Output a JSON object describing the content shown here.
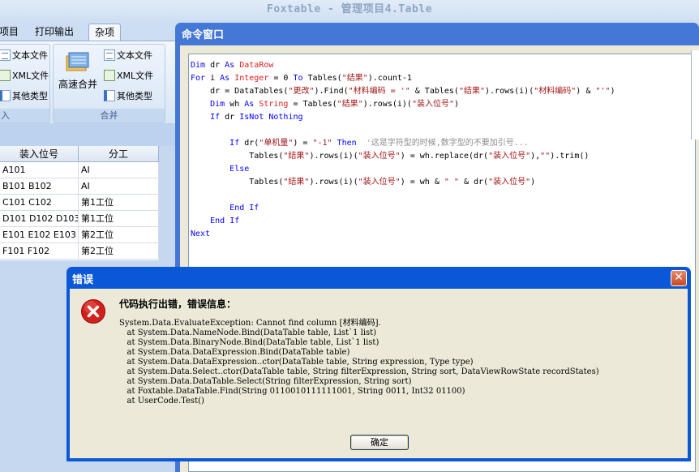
{
  "app": {
    "title": "Foxtable - 管理项目4.Table"
  },
  "tabs": [
    {
      "label": "项目"
    },
    {
      "label": "打印输出"
    },
    {
      "label": "杂项"
    }
  ],
  "ribbon": {
    "left_group": {
      "items": [
        "文本文件",
        "XML文件",
        "其他类型"
      ],
      "label": "入"
    },
    "merge_group": {
      "big_button": "高速合并",
      "items": [
        "文本文件",
        "XML文件",
        "其他类型"
      ],
      "label": "合并"
    }
  },
  "grid": {
    "columns": [
      "装入位号",
      "分工"
    ],
    "rows": [
      [
        "A101",
        "AI"
      ],
      [
        "B101 B102",
        "AI"
      ],
      [
        "C101 C102",
        "第1工位"
      ],
      [
        "D101 D102 D103",
        "第1工位"
      ],
      [
        "E101 E102 E103",
        "第2工位"
      ],
      [
        "F101 F102",
        "第2工位"
      ]
    ]
  },
  "command_window": {
    "title": "命令窗口",
    "code_lines": [
      "Dim dr As DataRow",
      "For i As Integer = 0 To Tables(\"结果\").count-1",
      "    dr = DataTables(\"更改\").Find(\"材料编码 = '\" & Tables(\"结果\").rows(i)(\"材料编码\") & \"'\")",
      "    Dim wh As String = Tables(\"结果\").rows(i)(\"装入位号\")",
      "    If dr IsNot Nothing",
      "",
      "        If dr(\"单机量\") = \"-1\" Then  '这是字符型的时候,数字型的不要加引号...",
      "            Tables(\"结果\").rows(i)(\"装入位号\") = wh.replace(dr(\"装入位号\"),\"\").trim()",
      "        Else",
      "            Tables(\"结果\").rows(i)(\"装入位号\") = wh & \" \" & dr(\"装入位号\")",
      "",
      "        End If",
      "    End If",
      "Next"
    ]
  },
  "error_dialog": {
    "title": "错误",
    "close_symbol": "✕",
    "headline": "代码执行出错，错误信息：",
    "details": [
      "System.Data.EvaluateException: Cannot find column [材料编码].",
      "   at System.Data.NameNode.Bind(DataTable table, List`1 list)",
      "   at System.Data.BinaryNode.Bind(DataTable table, List`1 list)",
      "   at System.Data.DataExpression.Bind(DataTable table)",
      "   at System.Data.DataExpression..ctor(DataTable table, String expression, Type type)",
      "   at System.Data.Select..ctor(DataTable table, String filterExpression, String sort, DataViewRowState recordStates)",
      "   at System.Data.DataTable.Select(String filterExpression, String sort)",
      "   at Foxtable.DataTable.Find(String 0110010111111001, String 0011, Int32 01100)",
      "   at UserCode.Test()"
    ],
    "ok_label": "确定"
  },
  "colors": {
    "title_bar": "#4477d6",
    "dialog_bar": "#0a58d8",
    "keyword": "#0000ff",
    "string": "#a31515",
    "comment": "#8c8c8c"
  }
}
